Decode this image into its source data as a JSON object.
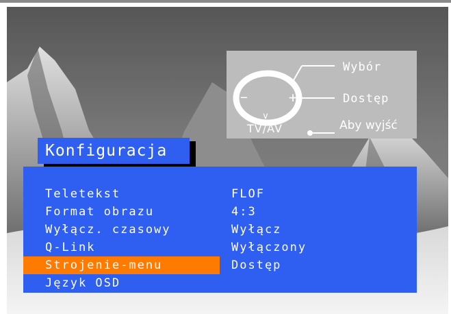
{
  "hint": {
    "select_label": "Wybór",
    "access_label": "Dostęp",
    "exit_label": "Aby wyjść",
    "tvav_label": "TV/AV"
  },
  "menu": {
    "title": "Konfiguracja",
    "items": [
      {
        "label": "Teletekst",
        "value": "FLOF",
        "selected": false
      },
      {
        "label": "Format obrazu",
        "value": "4:3",
        "selected": false
      },
      {
        "label": "Wyłącz. czasowy",
        "value": "Wyłącz",
        "selected": false
      },
      {
        "label": "Q-Link",
        "value": "Wyłączony",
        "selected": false
      },
      {
        "label": "Strojenie-menu",
        "value": "Dostęp",
        "selected": true
      },
      {
        "label": "Język OSD",
        "value": "",
        "selected": false
      }
    ]
  },
  "colors": {
    "menu_background": "#2f5ff0",
    "selection_highlight": "#ff7a00",
    "hint_panel": "#bcbcbc"
  },
  "icons": [
    "remote-navigation-ring-icon",
    "arrow-up-icon",
    "arrow-down-icon",
    "minus-icon",
    "plus-icon",
    "tvav-button-dot-icon"
  ]
}
